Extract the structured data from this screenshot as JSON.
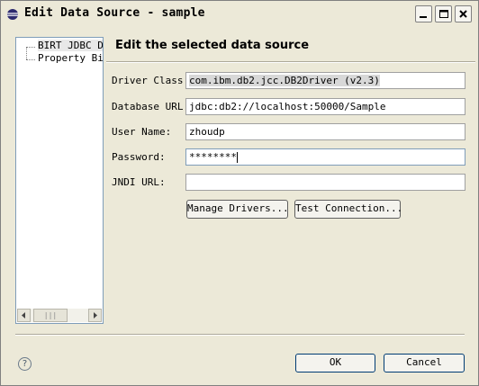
{
  "window": {
    "title": "Edit Data Source - sample",
    "controls": {
      "minimize": "minimize",
      "maximize": "maximize",
      "close": "close"
    }
  },
  "tree": {
    "items": [
      {
        "label": "BIRT JDBC Da",
        "selected": true
      },
      {
        "label": "Property Bin",
        "selected": false
      }
    ],
    "scrollbar": {
      "grip": "|||"
    }
  },
  "page": {
    "heading": "Edit the selected data source"
  },
  "form": {
    "driver_class": {
      "label": "Driver Class:",
      "value": "com.ibm.db2.jcc.DB2Driver (v2.3)"
    },
    "database_url": {
      "label": "Database URL:",
      "value": "jdbc:db2://localhost:50000/Sample"
    },
    "user_name": {
      "label": "User Name:",
      "value": "zhoudp"
    },
    "password": {
      "label": "Password:",
      "value": "********"
    },
    "jndi_url": {
      "label": "JNDI URL:",
      "value": ""
    }
  },
  "buttons": {
    "manage_drivers": "Manage Drivers...",
    "test_connection": "Test Connection...",
    "ok": "OK",
    "cancel": "Cancel",
    "help": "?"
  }
}
